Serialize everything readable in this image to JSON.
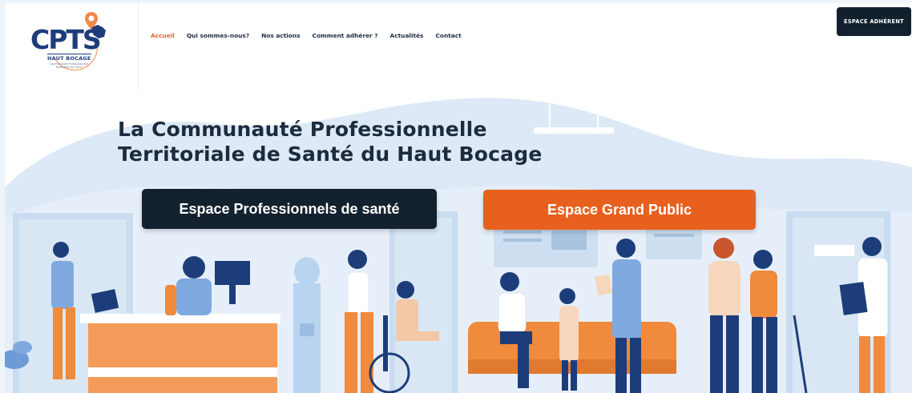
{
  "logo": {
    "word": "CPTS",
    "tagline": "HAUT BOCAGE",
    "subtitle": "Communauté Professionnelle Territoriale de Santé"
  },
  "nav": {
    "items": [
      {
        "label": "Accueil",
        "active": true
      },
      {
        "label": "Qui sommes-nous?",
        "active": false
      },
      {
        "label": "Nos actions",
        "active": false
      },
      {
        "label": "Comment adhérer ?",
        "active": false
      },
      {
        "label": "Actualités",
        "active": false
      },
      {
        "label": "Contact",
        "active": false
      }
    ]
  },
  "header": {
    "member_button": "ESPACE ADHÉRENT"
  },
  "hero": {
    "title_line1": "La Communauté Professionnelle",
    "title_line2": "Territoriale de Santé du Haut Bocage",
    "cta_pro": "Espace Professionnels de santé",
    "cta_public": "Espace Grand Public"
  },
  "colors": {
    "accent": "#e8601e",
    "dark": "#13212f",
    "brand": "#1d3d7a",
    "hero_bg": "#dde9f6"
  }
}
